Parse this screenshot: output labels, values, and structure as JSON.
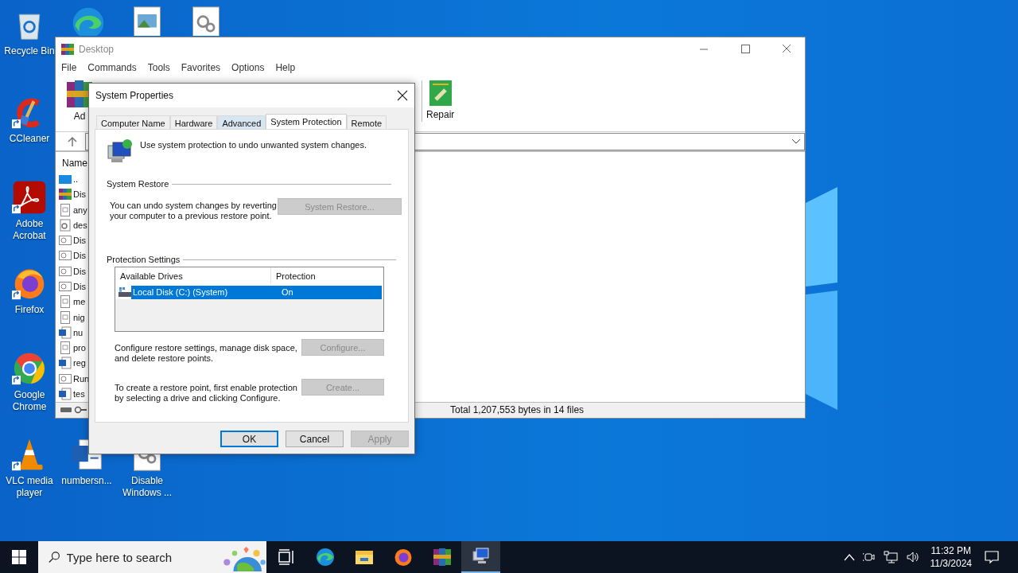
{
  "desktop_icons": [
    {
      "kind": "recycle-bin",
      "label": "Recycle Bin",
      "shortcut": false
    },
    {
      "kind": "ccleaner",
      "label": "CCleaner",
      "shortcut": true
    },
    {
      "kind": "acrobat",
      "label": "Adobe Acrobat",
      "shortcut": true
    },
    {
      "kind": "firefox",
      "label": "Firefox",
      "shortcut": true
    },
    {
      "kind": "chrome",
      "label": "Google Chrome",
      "shortcut": true
    },
    {
      "kind": "vlc",
      "label": "VLC media player",
      "shortcut": true
    },
    {
      "kind": "edge",
      "shortcut": false
    },
    {
      "kind": "image-file",
      "shortcut": false
    },
    {
      "kind": "settings-file",
      "shortcut": false
    },
    {
      "kind": "word-doc",
      "label": "numbersn...",
      "shortcut": false
    },
    {
      "kind": "settings-file",
      "label": "Disable Windows ...",
      "shortcut": false
    }
  ],
  "winrar": {
    "title": "Desktop",
    "menu": [
      "File",
      "Commands",
      "Tools",
      "Favorites",
      "Options",
      "Help"
    ],
    "toolbar": [
      {
        "kind": "add",
        "label": "Ad"
      },
      {
        "kind": "repair",
        "label": "Repair"
      }
    ],
    "list_header": "Name",
    "files": [
      {
        "kind": "up",
        "name": ".."
      },
      {
        "kind": "archive",
        "name": "Dis"
      },
      {
        "kind": "text",
        "name": "any"
      },
      {
        "kind": "settings",
        "name": "des"
      },
      {
        "kind": "generic",
        "name": "Dis"
      },
      {
        "kind": "generic",
        "name": "Dis"
      },
      {
        "kind": "generic",
        "name": "Dis"
      },
      {
        "kind": "generic",
        "name": "Dis"
      },
      {
        "kind": "text",
        "name": "me"
      },
      {
        "kind": "text",
        "name": "nig"
      },
      {
        "kind": "word",
        "name": "nu"
      },
      {
        "kind": "text",
        "name": "pro"
      },
      {
        "kind": "word",
        "name": "reg"
      },
      {
        "kind": "generic",
        "name": "Run"
      },
      {
        "kind": "word",
        "name": "tes"
      }
    ],
    "status": "Total 1,207,553 bytes in 14 files"
  },
  "dialog": {
    "title": "System Properties",
    "tabs": [
      {
        "label": "Computer Name",
        "selected": false,
        "hovered": false
      },
      {
        "label": "Hardware",
        "selected": false,
        "hovered": false
      },
      {
        "label": "Advanced",
        "selected": false,
        "hovered": true
      },
      {
        "label": "System Protection",
        "selected": true,
        "hovered": false
      },
      {
        "label": "Remote",
        "selected": false,
        "hovered": false
      }
    ],
    "intro": "Use system protection to undo unwanted system changes.",
    "system_restore": {
      "heading": "System Restore",
      "text": "You can undo system changes by reverting\nyour computer to a previous restore point.",
      "button": {
        "label": "System Restore...",
        "disabled": true
      }
    },
    "protection": {
      "heading": "Protection Settings",
      "columns": [
        "Available Drives",
        "Protection"
      ],
      "drives": [
        {
          "name": "Local Disk (C:) (System)",
          "protection": "On",
          "selected": true
        }
      ],
      "configure": {
        "text": "Configure restore settings, manage disk space,\nand delete restore points.",
        "button": {
          "label": "Configure...",
          "disabled": true
        }
      },
      "create": {
        "text": "To create a restore point, first enable protection\nby selecting a drive and clicking Configure.",
        "button": {
          "label": "Create...",
          "disabled": true
        }
      }
    },
    "buttons": [
      {
        "label": "OK",
        "default": true,
        "disabled": false
      },
      {
        "label": "Cancel",
        "default": false,
        "disabled": false
      },
      {
        "label": "Apply",
        "default": false,
        "disabled": true
      }
    ]
  },
  "taskbar": {
    "search": {
      "placeholder": "Type here to search"
    },
    "apps": [
      {
        "kind": "task-view",
        "active": false
      },
      {
        "kind": "edge",
        "active": false
      },
      {
        "kind": "explorer",
        "active": false
      },
      {
        "kind": "firefox",
        "active": false
      },
      {
        "kind": "winrar",
        "active": false
      },
      {
        "kind": "system",
        "active": true
      }
    ],
    "time": "11:32 PM",
    "date": "11/3/2024"
  }
}
